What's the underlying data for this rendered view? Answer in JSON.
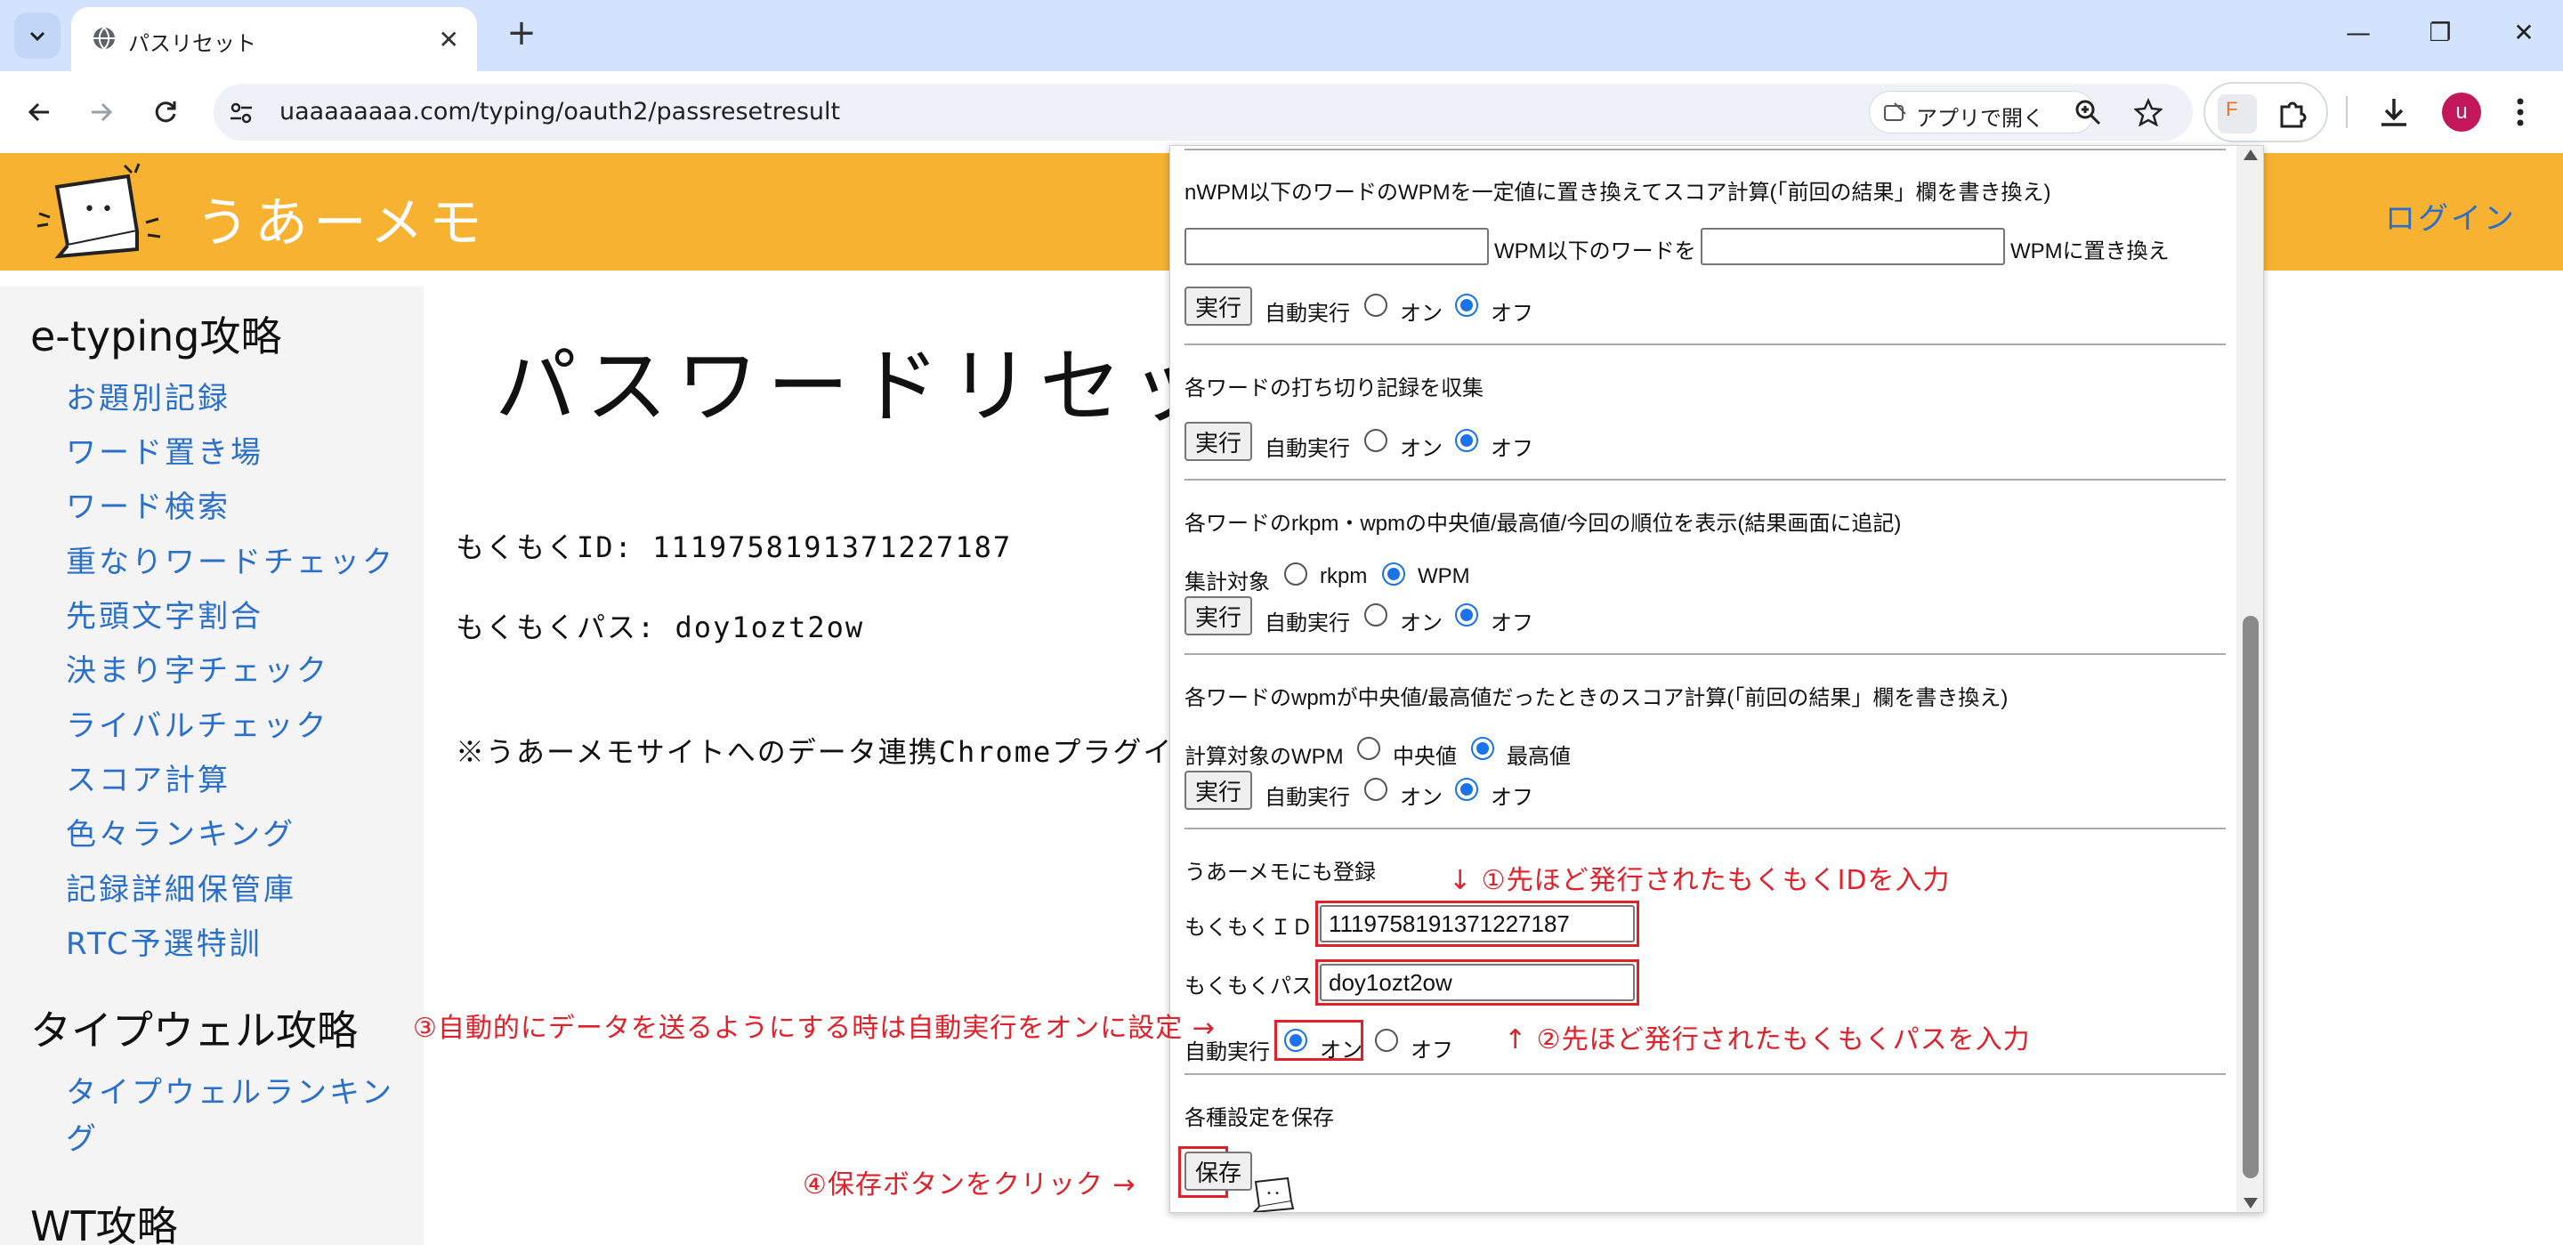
{
  "browser": {
    "tab_title": "パスリセット",
    "url": "uaaaaaaaa.com/typing/oauth2/passresetresult",
    "open_app_label": "アプリで開く",
    "avatar_letter": "u",
    "ext_letter": "F"
  },
  "site": {
    "title": "うあーメモ",
    "login": "ログイン",
    "sidebar": {
      "etyping_heading": "e-typing攻略",
      "etyping_items": [
        "お題別記録",
        "ワード置き場",
        "ワード検索",
        "重なりワードチェック",
        "先頭文字割合",
        "決まり字チェック",
        "ライバルチェック",
        "スコア計算",
        "色々ランキング",
        "記録詳細保管庫",
        "RTC予選特訓"
      ],
      "typewell_heading": "タイプウェル攻略",
      "typewell_items": [
        "タイプウェルランキン",
        "グ"
      ],
      "wt_heading": "WT攻略"
    },
    "main": {
      "title": "パスワードリセット",
      "id_line": "もくもくID: 1119758191371227187",
      "pass_line": "もくもくパス: doy1ozt2ow",
      "note_line": "※うあーメモサイトへのデータ連携Chromeプラグイ"
    }
  },
  "popup": {
    "sec1_title": "nWPM以下のワードのWPMを一定値に置き換えてスコア計算(「前回の結果」欄を書き換え)",
    "sec1_label_mid": "WPM以下のワードを",
    "sec1_label_end": "WPMに置き換え",
    "run_label": "実行",
    "auto_run_label": "自動実行",
    "on_label": "オン",
    "off_label": "オフ",
    "sec2_title": "各ワードの打ち切り記録を収集",
    "sec3_title": "各ワードのrkpm・wpmの中央値/最高値/今回の順位を表示(結果画面に追記)",
    "sec3_target_label": "集計対象",
    "sec3_opt_rkpm": "rkpm",
    "sec3_opt_wpm": "WPM",
    "sec4_title": "各ワードのwpmが中央値/最高値だったときのスコア計算(「前回の結果」欄を書き換え)",
    "sec4_target_label": "計算対象のWPM",
    "sec4_opt_median": "中央値",
    "sec4_opt_max": "最高値",
    "sec5_title": "うあーメモにも登録",
    "id_label": "もくもくＩＤ",
    "id_value": "1119758191371227187",
    "pass_label": "もくもくパス",
    "pass_value": "doy1ozt2ow",
    "save_section_title": "各種設定を保存",
    "save_label": "保存"
  },
  "annotations": {
    "a1": "↓ ①先ほど発行されたもくもくIDを入力",
    "a2": "↑ ②先ほど発行されたもくもくパスを入力",
    "a3": "③自動的にデータを送るようにする時は自動実行をオンに設定 →",
    "a4": "④保存ボタンをクリック →"
  },
  "colors": {
    "header_orange": "#f7b232",
    "link_blue": "#2a6fc9",
    "annotation_red": "#e0202a",
    "radio_blue": "#1a73e8"
  }
}
